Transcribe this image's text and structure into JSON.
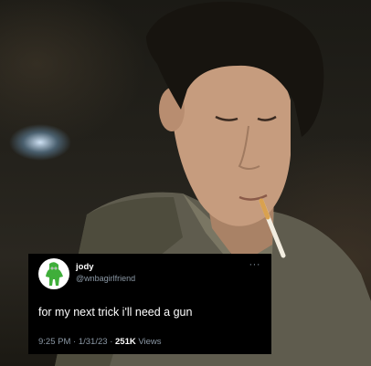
{
  "photo": {
    "subject": "young man with dark hair, head lowered, cigarette in mouth, wearing a green-grey jacket",
    "palette": {
      "background": "#1f1d17",
      "light": "#cfe4f5",
      "skin": "#c9a184",
      "hair": "#15130f",
      "jacket": "#6e6a5a"
    }
  },
  "tweet": {
    "display_name": "jody",
    "handle": "@wnbagirlfriend",
    "more_label": "···",
    "text": "for my next trick i'll need a gun",
    "time": "9:25 PM",
    "separator": "·",
    "date": "1/31/23",
    "views_count": "251K",
    "views_label": "Views",
    "avatar_icon": "gumby-icon",
    "colors": {
      "card_background": "#000000",
      "primary_text": "#ffffff",
      "secondary_text": "#8b98a5",
      "avatar_figure": "#3fae3a"
    }
  }
}
